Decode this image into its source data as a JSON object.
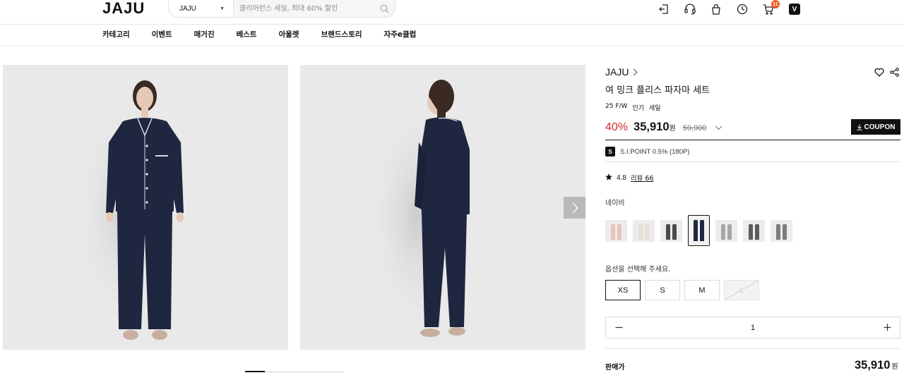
{
  "header": {
    "logo": "JAJU",
    "search_brand": "JAJU",
    "search_placeholder": "클리어런스 세일, 최대 60% 할인",
    "cart_count": "11",
    "v_label": "V",
    "icons": [
      "logout-icon",
      "customer-service-icon",
      "shopping-bag-icon",
      "recent-view-icon",
      "cart-icon",
      "v-icon"
    ]
  },
  "gnb": [
    "카테고리",
    "이벤트",
    "매거진",
    "베스트",
    "아울렛",
    "브랜드스토리",
    "자주e클럽"
  ],
  "gallery": {
    "progress": 0.2
  },
  "product": {
    "brand": "JAJU",
    "name": "여 밍크 플리스 파자마 세트",
    "tags": [
      "25 F/W",
      "인기",
      "세일"
    ],
    "discount": "40%",
    "sale_price": "35,910",
    "won": "원",
    "original_price": "59,900",
    "coupon_label": "COUPON",
    "point_icon_label": "S",
    "point_text": "S.I.POINT 0.5% (180P)",
    "rating": "4.8",
    "review_text": "리뷰 66",
    "color_name": "네이비",
    "option_prompt": "옵션을 선택해 주세요.",
    "sizes": [
      "XS",
      "S",
      "M",
      "L"
    ],
    "quantity": "1",
    "total_label": "판매가",
    "total_price": "35,910"
  },
  "colors": {
    "accent_red": "#d42a2a",
    "dark": "#111111",
    "navy": "#1e2640"
  }
}
